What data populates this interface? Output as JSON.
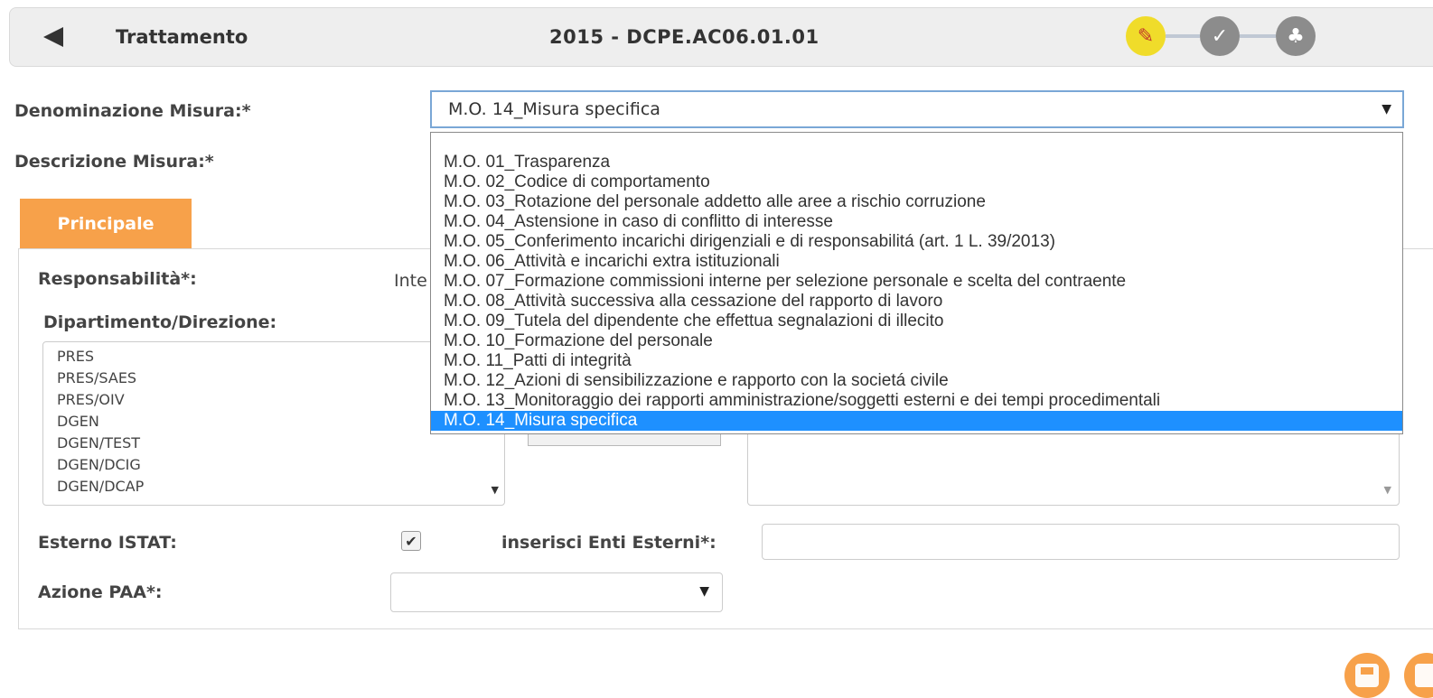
{
  "header": {
    "back_icon": "back-arrow-icon",
    "title": "Trattamento",
    "code": "2015 - DCPE.AC06.01.01",
    "steps": [
      {
        "icon": "pencil-icon",
        "glyph": "✎",
        "color": "#f0dc2a"
      },
      {
        "icon": "check-icon",
        "glyph": "✓",
        "color": "#8c8c8c"
      },
      {
        "icon": "users-icon",
        "glyph": "♣",
        "color": "#8c8c8c"
      }
    ]
  },
  "form": {
    "denominazione_label": "Denominazione Misura:*",
    "denominazione_value": "M.O. 14_Misura specifica",
    "descrizione_label": "Descrizione Misura:*",
    "options": [
      "M.O. 01_Trasparenza",
      "M.O. 02_Codice di comportamento",
      "M.O. 03_Rotazione del personale addetto alle aree a rischio corruzione",
      "M.O. 04_Astensione in caso di conflitto di interesse",
      "M.O. 05_Conferimento incarichi dirigenziali e di responsabilitá (art. 1 L. 39/2013)",
      "M.O. 06_Attività e incarichi extra istituzionali",
      "M.O. 07_Formazione commissioni interne per selezione personale e scelta del contraente",
      "M.O. 08_Attività successiva alla cessazione del rapporto di lavoro",
      "M.O. 09_Tutela del dipendente che effettua segnalazioni di illecito",
      "M.O. 10_Formazione del personale",
      "M.O. 11_Patti di integrità",
      "M.O. 12_Azioni di sensibilizzazione e rapporto con la societá civile",
      "M.O. 13_Monitoraggio dei rapporti amministrazione/soggetti esterni e dei tempi procedimentali",
      "M.O. 14_Misura specifica"
    ],
    "selected_option": "M.O. 14_Misura specifica"
  },
  "tab": {
    "label": "Principale",
    "color": "#f7a14a"
  },
  "panel": {
    "responsabilita_label": "Responsabilità*:",
    "responsabilita_partial": "Inte",
    "dipartimento_label": "Dipartimento/Direzione:",
    "dipartimenti": [
      "PRES",
      "PRES/SAES",
      "PRES/OIV",
      "DGEN",
      "DGEN/TEST",
      "DGEN/DCIG",
      "DGEN/DCAP"
    ],
    "esterno_label": "Esterno ISTAT:",
    "esterno_checked": true,
    "enti_label": "inserisci Enti Esterni*:",
    "enti_value": "",
    "azione_label": "Azione PAA*:",
    "azione_value": ""
  },
  "actions": [
    {
      "icon": "save-icon"
    },
    {
      "icon": "document-icon"
    }
  ],
  "colors": {
    "accent": "#f7a14a",
    "highlight": "#1e90ff"
  }
}
